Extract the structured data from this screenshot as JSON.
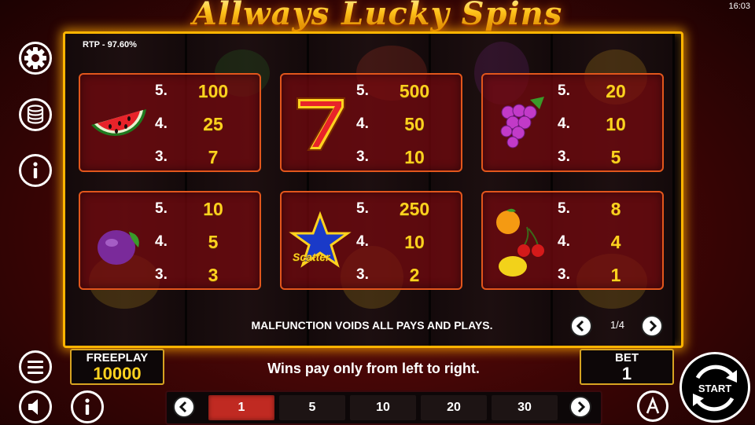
{
  "title": "Allways Lucky Spins",
  "clock": "16:03",
  "rtp": "RTP - 97.60%",
  "paytable": [
    {
      "symbol": "watermelon-icon",
      "rows": [
        {
          "count": "5.",
          "pay": "100"
        },
        {
          "count": "4.",
          "pay": "25"
        },
        {
          "count": "3.",
          "pay": "7"
        }
      ]
    },
    {
      "symbol": "seven-icon",
      "rows": [
        {
          "count": "5.",
          "pay": "500"
        },
        {
          "count": "4.",
          "pay": "50"
        },
        {
          "count": "3.",
          "pay": "10"
        }
      ]
    },
    {
      "symbol": "grapes-icon",
      "rows": [
        {
          "count": "5.",
          "pay": "20"
        },
        {
          "count": "4.",
          "pay": "10"
        },
        {
          "count": "3.",
          "pay": "5"
        }
      ]
    },
    {
      "symbol": "plum-icon",
      "rows": [
        {
          "count": "5.",
          "pay": "10"
        },
        {
          "count": "4.",
          "pay": "5"
        },
        {
          "count": "3.",
          "pay": "3"
        }
      ]
    },
    {
      "symbol": "scatter-star-icon",
      "label": "Scatter",
      "rows": [
        {
          "count": "5.",
          "pay": "250"
        },
        {
          "count": "4.",
          "pay": "10"
        },
        {
          "count": "3.",
          "pay": "2"
        }
      ]
    },
    {
      "symbol": "orange-cherry-lemon-icon",
      "rows": [
        {
          "count": "5.",
          "pay": "8"
        },
        {
          "count": "4.",
          "pay": "4"
        },
        {
          "count": "3.",
          "pay": "1"
        }
      ]
    }
  ],
  "malfunction_text": "MALFUNCTION VOIDS ALL PAYS AND PLAYS.",
  "pager": {
    "current": "1/4",
    "prev_icon": "chevron-left-icon",
    "next_icon": "chevron-right-icon"
  },
  "freeplay": {
    "label": "FREEPLAY",
    "value": "10000"
  },
  "bet": {
    "label": "BET",
    "value": "1"
  },
  "wins_text": "Wins pay only from left to right.",
  "lines": {
    "options": [
      "1",
      "5",
      "10",
      "20",
      "30"
    ],
    "selected": "1"
  },
  "start_label": "START",
  "colors": {
    "accent_gold": "#ffb400",
    "pay_yellow": "#ffd21f",
    "card_border": "#e2561c",
    "active_line": "#c02a22"
  }
}
